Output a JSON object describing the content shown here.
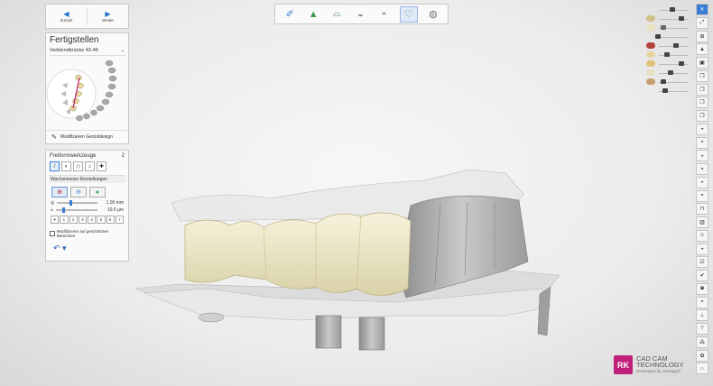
{
  "nav": {
    "back_label": "Zurück",
    "next_label": "Weiter"
  },
  "finish_panel": {
    "title": "Fertigstellen",
    "dropdown_value": "Verblendbrücke 43-46",
    "action_label": "Modifizieren Gerüstdesign"
  },
  "tools_panel": {
    "title": "Freiformwerkzeuge",
    "counter": "2",
    "sub_title": "Wachsmesser Einstellungen",
    "radius_value": "1.00 mm",
    "strength_value": "10.0 µm",
    "numbers": [
      "1",
      "2",
      "3",
      "4",
      "5",
      "6",
      "7"
    ],
    "checkbox_label": "Modifizieren auf geschützten Bereichen"
  },
  "brand": {
    "logo": "RK",
    "line1": "CAD CAM",
    "line2": "TECHNOLOGY",
    "line3": "Developed by zahnapp®"
  },
  "colors": {
    "accent": "#3a7bd5",
    "brand": "#c0207a",
    "tooth": "#ece6c2",
    "gingiva": "#bdbdbd"
  }
}
